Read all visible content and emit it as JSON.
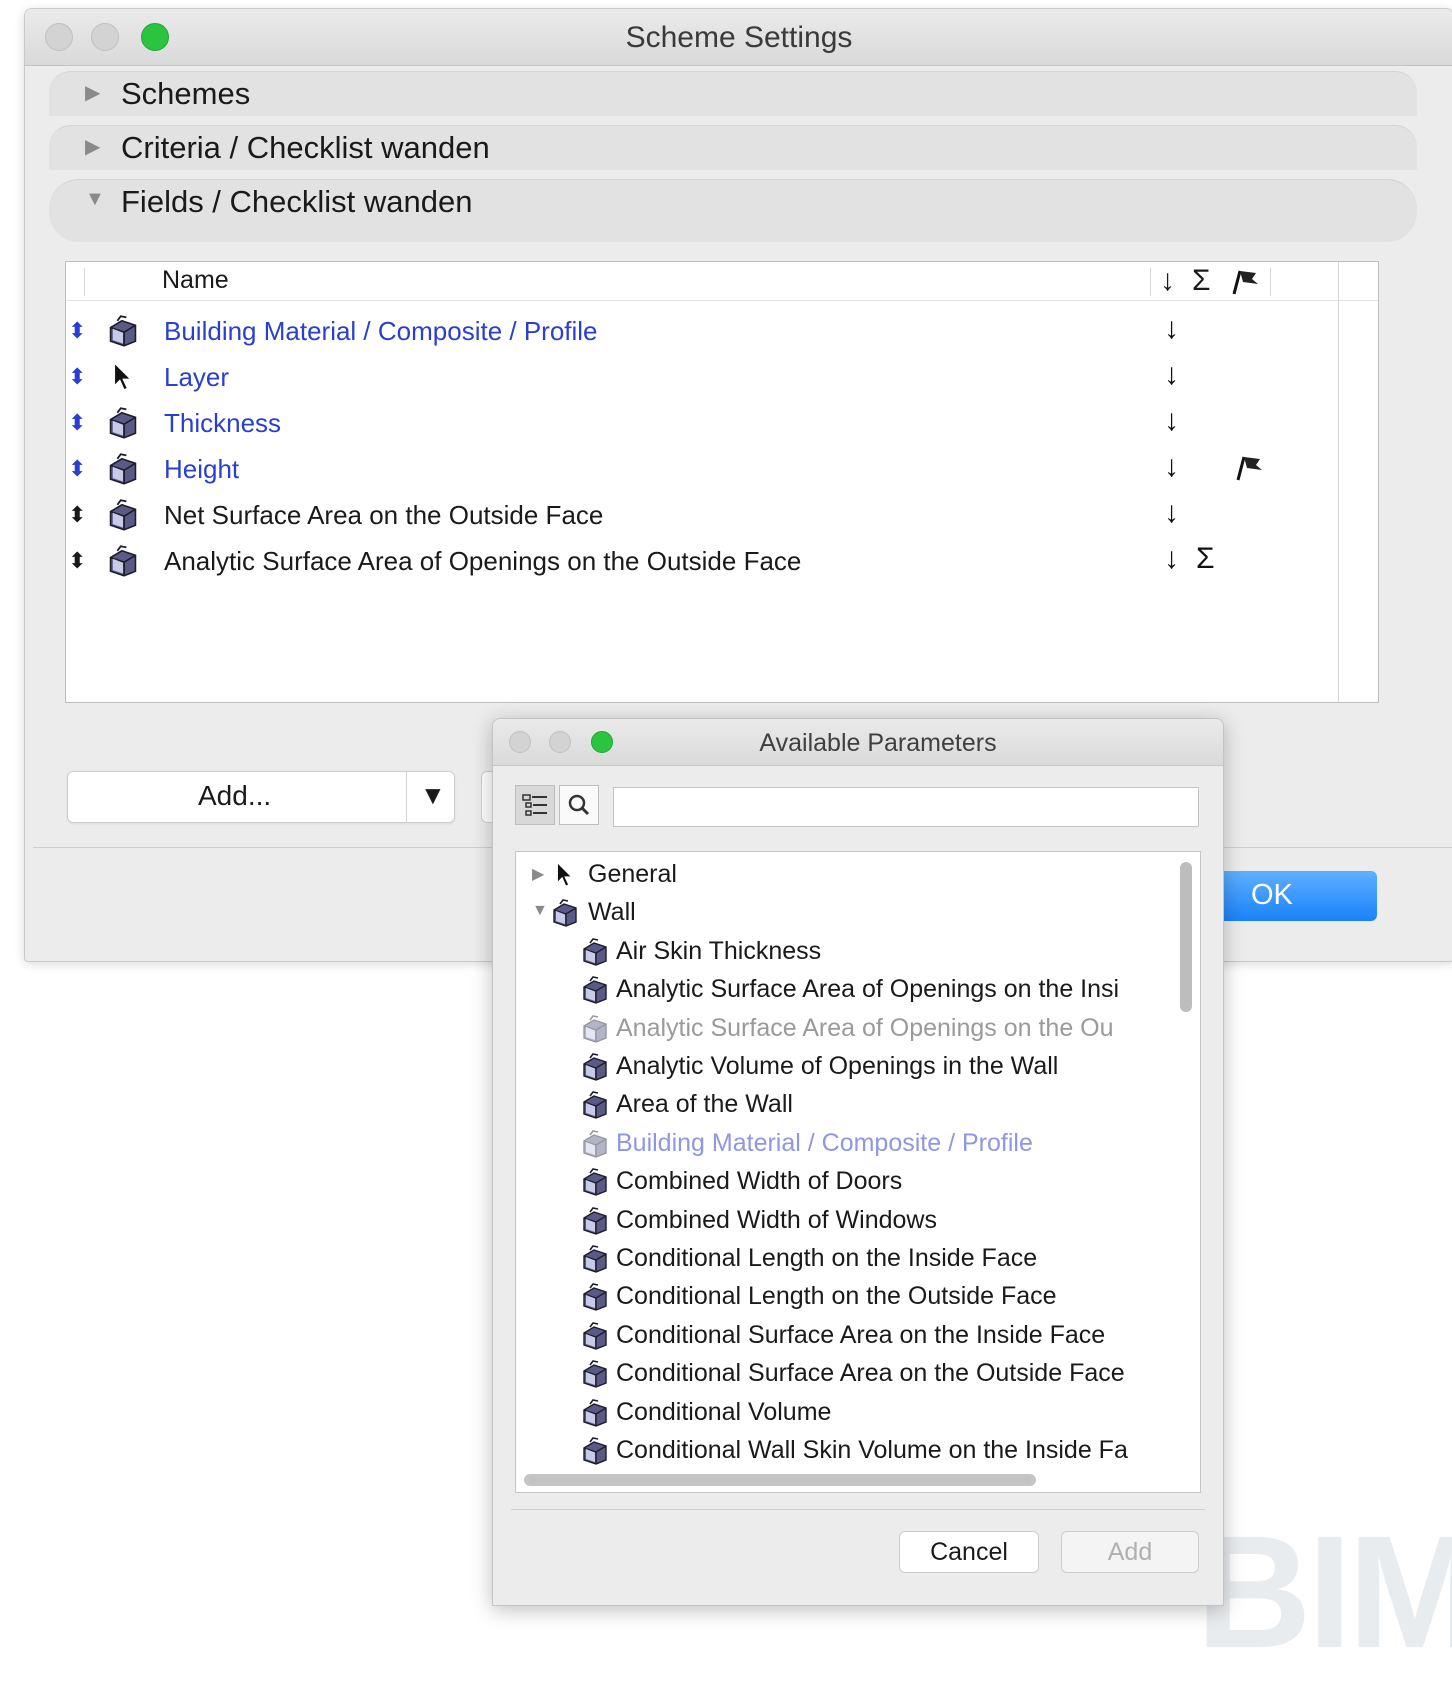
{
  "main_window": {
    "title": "Scheme Settings",
    "sections": [
      {
        "label": "Schemes",
        "expanded": false
      },
      {
        "label": "Criteria /  Checklist wanden",
        "expanded": false
      },
      {
        "label": "Fields /  Checklist wanden",
        "expanded": true
      }
    ],
    "table": {
      "header_name": "Name",
      "header_sort_icon": "↓",
      "header_sum_icon": "Σ",
      "rows": [
        {
          "name": "Building Material / Composite / Profile",
          "icon": "wall-icon",
          "blue": true,
          "sort": "↓",
          "sum": "",
          "flag": false
        },
        {
          "name": "Layer",
          "icon": "cursor-icon",
          "blue": true,
          "sort": "↓",
          "sum": "",
          "flag": false
        },
        {
          "name": "Thickness",
          "icon": "wall-icon",
          "blue": true,
          "sort": "↓",
          "sum": "",
          "flag": false
        },
        {
          "name": "Height",
          "icon": "wall-icon",
          "blue": true,
          "sort": "↓",
          "sum": "",
          "flag": true
        },
        {
          "name": "Net Surface Area on the Outside Face",
          "icon": "wall-icon",
          "blue": false,
          "sort": "↓",
          "sum": "",
          "flag": false
        },
        {
          "name": "Analytic Surface Area of Openings on the Outside Face",
          "icon": "wall-icon",
          "blue": false,
          "sort": "↓",
          "sum": "Σ",
          "flag": false
        }
      ]
    },
    "add_button": "Add...",
    "ok_button": "OK"
  },
  "palette": {
    "title": "Available Parameters",
    "search_value": "",
    "tree": [
      {
        "label": "General",
        "level": 0,
        "disclosure": "▶",
        "icon": "cursor-icon",
        "state": "normal"
      },
      {
        "label": "Wall",
        "level": 0,
        "disclosure": "▼",
        "icon": "wall-icon",
        "state": "normal"
      },
      {
        "label": "Air Skin Thickness",
        "level": 1,
        "icon": "wall-icon",
        "state": "normal"
      },
      {
        "label": "Analytic Surface Area of Openings on the Insi",
        "level": 1,
        "icon": "wall-icon",
        "state": "normal"
      },
      {
        "label": "Analytic Surface Area of Openings on the Ou",
        "level": 1,
        "icon": "wall-icon",
        "state": "dim"
      },
      {
        "label": "Analytic Volume of Openings in the Wall",
        "level": 1,
        "icon": "wall-icon",
        "state": "normal"
      },
      {
        "label": "Area of the Wall",
        "level": 1,
        "icon": "wall-icon",
        "state": "normal"
      },
      {
        "label": "Building Material / Composite / Profile",
        "level": 1,
        "icon": "wall-icon",
        "state": "dimblue"
      },
      {
        "label": "Combined Width of Doors",
        "level": 1,
        "icon": "wall-icon",
        "state": "normal"
      },
      {
        "label": "Combined Width of Windows",
        "level": 1,
        "icon": "wall-icon",
        "state": "normal"
      },
      {
        "label": "Conditional Length on the Inside Face",
        "level": 1,
        "icon": "wall-icon",
        "state": "normal"
      },
      {
        "label": "Conditional Length on the Outside Face",
        "level": 1,
        "icon": "wall-icon",
        "state": "normal"
      },
      {
        "label": "Conditional Surface Area on the Inside Face",
        "level": 1,
        "icon": "wall-icon",
        "state": "normal"
      },
      {
        "label": "Conditional Surface Area on the Outside Face",
        "level": 1,
        "icon": "wall-icon",
        "state": "normal"
      },
      {
        "label": "Conditional Volume",
        "level": 1,
        "icon": "wall-icon",
        "state": "normal"
      },
      {
        "label": "Conditional Wall Skin Volume on the Inside Fa",
        "level": 1,
        "icon": "wall-icon",
        "state": "normal"
      }
    ],
    "cancel_button": "Cancel",
    "add_button": "Add"
  },
  "colors": {
    "accent_blue": "#2a3fd0",
    "ok_button": "#1a82fb",
    "traffic_green": "#2bc43f"
  }
}
